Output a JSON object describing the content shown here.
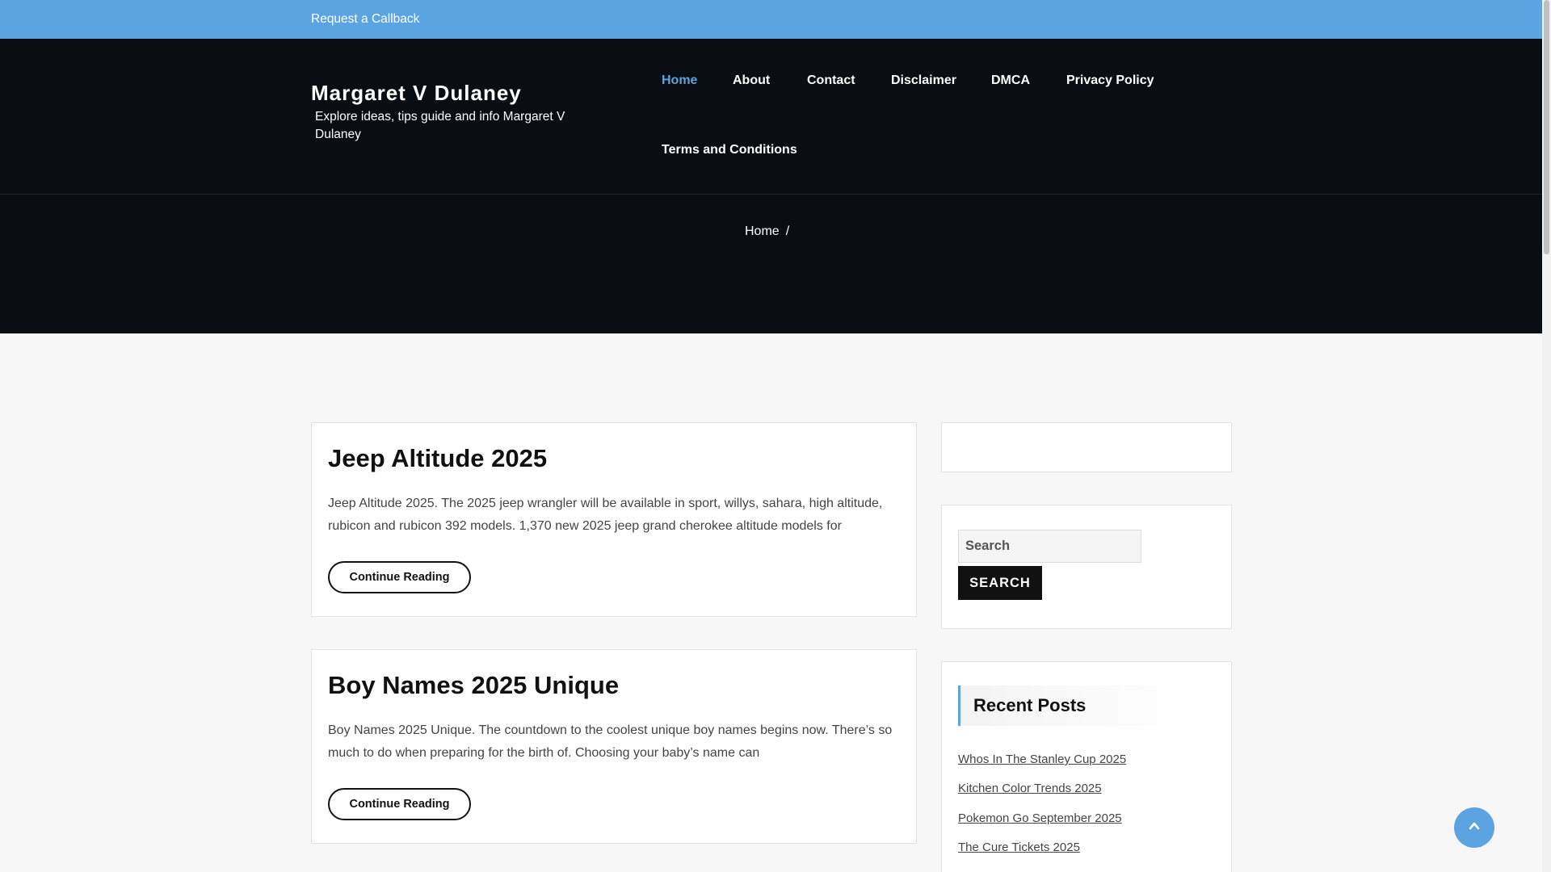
{
  "topbar": {
    "callback_label": "Request a Callback"
  },
  "site": {
    "title": "Margaret V Dulaney",
    "tagline": "Explore ideas, tips guide and info Margaret V Dulaney"
  },
  "nav": {
    "items": [
      {
        "label": "Home"
      },
      {
        "label": "About"
      },
      {
        "label": "Contact"
      },
      {
        "label": "Disclaimer"
      },
      {
        "label": "DMCA"
      },
      {
        "label": "Privacy Policy"
      },
      {
        "label": "Terms and Conditions"
      }
    ]
  },
  "breadcrumb": {
    "home": "Home",
    "separator": "/"
  },
  "posts": [
    {
      "title": "Jeep Altitude 2025",
      "excerpt": "Jeep Altitude 2025. The 2025 jeep wrangler will be available in sport, willys, sahara, high altitude, rubicon and rubicon 392 models. 1,370 new 2025 jeep grand cherokee altitude models for",
      "button": "Continue Reading"
    },
    {
      "title": "Boy Names 2025 Unique",
      "excerpt": "Boy Names 2025 Unique. The countdown to the coolest unique boy names begins now. There’s so much to do when preparing for the birth of. Choosing your baby’s name can",
      "button": "Continue Reading"
    }
  ],
  "sidebar": {
    "search": {
      "placeholder": "Search",
      "button": "SEARCH"
    },
    "recent": {
      "heading": "Recent Posts",
      "items": [
        "Whos In The Stanley Cup 2025",
        "Kitchen Color Trends 2025",
        "Pokemon Go September 2025",
        "The Cure Tickets 2025"
      ]
    }
  },
  "colors": {
    "accent": "#5ba4e1",
    "header_bg": "#0a0d12",
    "page_bg": "#f7f7f7"
  },
  "icons": {
    "back_to_top": "chevron-up-icon"
  }
}
